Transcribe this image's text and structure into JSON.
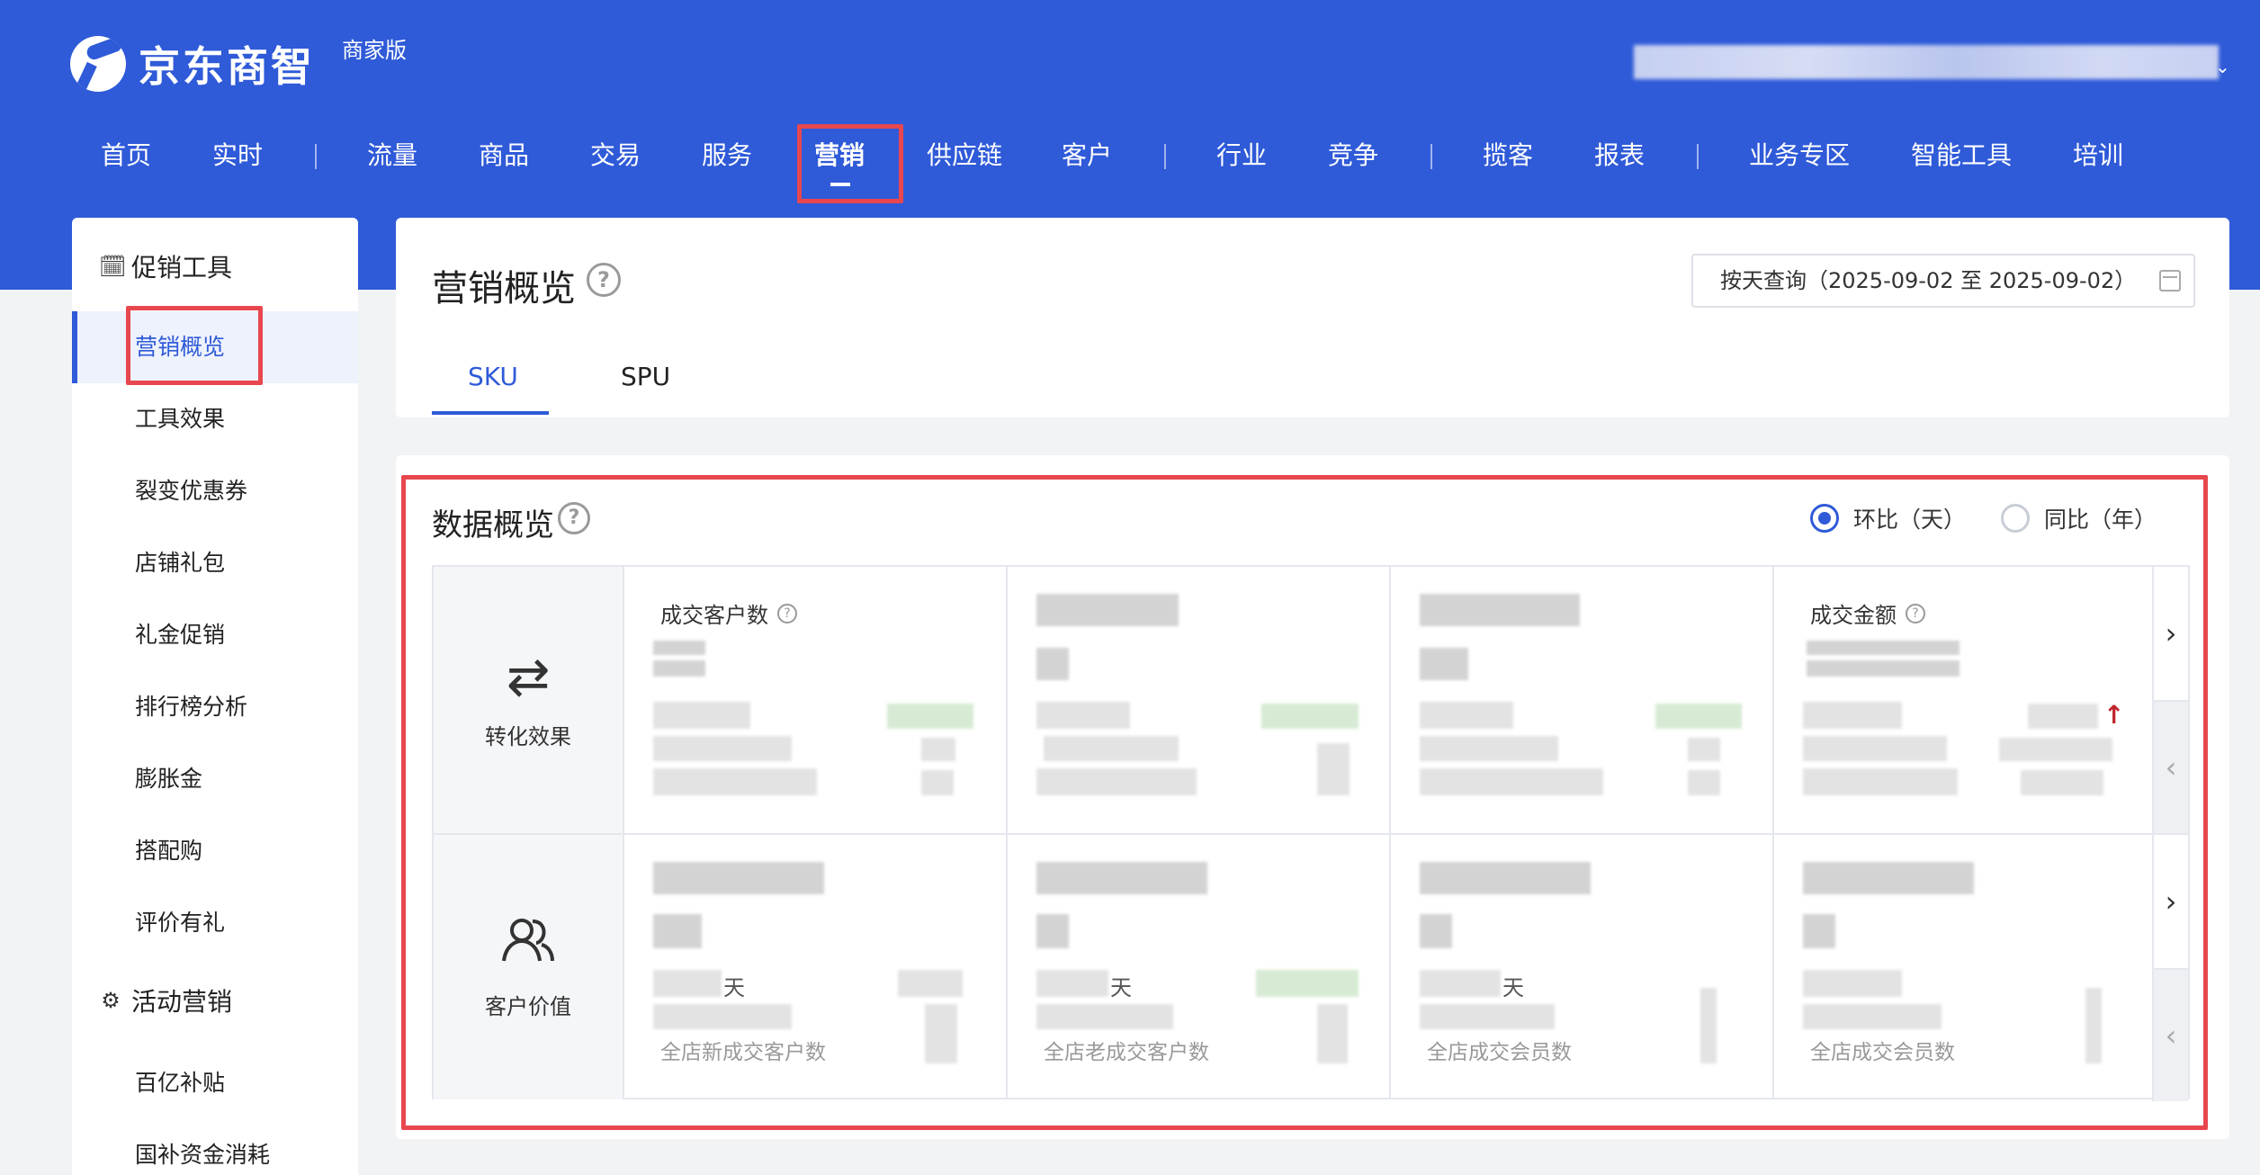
{
  "brand": {
    "logo_text": "京东商智",
    "edition": "商家版"
  },
  "topnav": {
    "items": [
      "首页",
      "实时",
      "流量",
      "商品",
      "交易",
      "服务",
      "营销",
      "供应链",
      "客户",
      "行业",
      "竞争",
      "揽客",
      "报表",
      "业务专区",
      "智能工具",
      "培训"
    ],
    "active": "营销"
  },
  "sidebar": {
    "group1": "促销工具",
    "group1_items": [
      "营销概览",
      "工具效果",
      "裂变优惠券",
      "店铺礼包",
      "礼金促销",
      "排行榜分析",
      "膨胀金",
      "搭配购",
      "评价有礼"
    ],
    "group2": "活动营销",
    "group2_items": [
      "百亿补贴",
      "国补资金消耗"
    ],
    "active": "营销概览"
  },
  "header": {
    "title": "营销概览",
    "date_query": "按天查询（2025-09-02 至 2025-09-02）",
    "tabs": [
      "SKU",
      "SPU"
    ],
    "active_tab": "SKU"
  },
  "overview": {
    "title": "数据概览",
    "compare_options": [
      "环比（天）",
      "同比（年）"
    ],
    "compare_selected": "环比（天）",
    "rows": [
      {
        "label": "转化效果",
        "icon": "exchange-icon"
      },
      {
        "label": "客户价值",
        "icon": "users-icon"
      }
    ],
    "row1_cells": [
      "成交客户数",
      "",
      "",
      "成交金额"
    ],
    "row2_footers": [
      "全店新成交客户数",
      "全店老成交客户数",
      "全店成交会员数",
      "全店成交会员数"
    ],
    "day_unit": "天",
    "up_arrow": "↑"
  },
  "colors": {
    "primary": "#2f5ad8",
    "highlight_box": "#e8474f"
  }
}
